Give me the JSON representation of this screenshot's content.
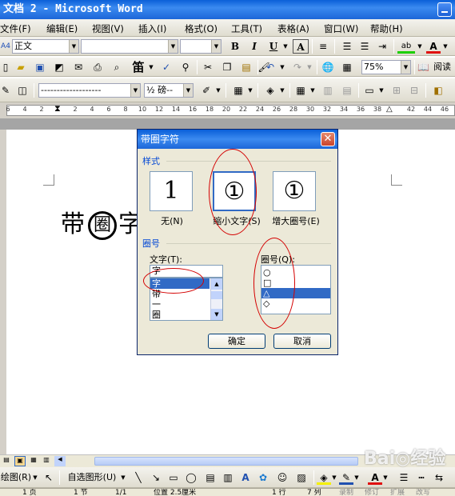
{
  "window": {
    "title": "文档 2 - Microsoft Word"
  },
  "menubar": {
    "items": [
      "文件(F)",
      "编辑(E)",
      "视图(V)",
      "插入(I)",
      "格式(O)",
      "工具(T)",
      "表格(A)",
      "窗口(W)",
      "帮助(H)"
    ]
  },
  "format_toolbar": {
    "style_value": "正文",
    "bold": "B",
    "italic": "I",
    "underline": "U",
    "char_border": "A",
    "highlight": "ab",
    "font_color": "A"
  },
  "standard_toolbar": {
    "zoom_value": "75%",
    "read_label": "阅读",
    "char_button": "笛"
  },
  "third_toolbar": {
    "line_style": "-------------------",
    "line_weight": "½ 磅--"
  },
  "ruler": {
    "ticks": [
      "6",
      "4",
      "2",
      "2",
      "4",
      "6",
      "8",
      "10",
      "12",
      "14",
      "16",
      "18",
      "20",
      "22",
      "24",
      "26",
      "28",
      "30",
      "32",
      "34",
      "36",
      "38",
      "42",
      "44",
      "46"
    ]
  },
  "document": {
    "sample_text": "带",
    "sample_circled": "圈",
    "sample_after": "字"
  },
  "dialog": {
    "title": "带圈字符",
    "style_group": "样式",
    "styles": [
      {
        "glyph": "1",
        "label": "无(N)"
      },
      {
        "glyph": "①",
        "label": "缩小文字(S)"
      },
      {
        "glyph": "①",
        "label": "增大圈号(E)"
      }
    ],
    "circle_group": "圈号",
    "text_label": "文字(T):",
    "text_value": "字",
    "text_items": [
      "字",
      "带",
      "一",
      "圈"
    ],
    "shape_label": "圈号(Q):",
    "shape_items": [
      "○",
      "□",
      "△",
      "◇"
    ],
    "ok_label": "确定",
    "cancel_label": "取消"
  },
  "draw_toolbar": {
    "draw_label": "绘图(R)",
    "autoshape_label": "自选图形(U)"
  },
  "statusbar": {
    "page": "1 页",
    "section": "1 节",
    "pages": "1/1",
    "position": "位置 2.5厘米",
    "line": "1 行",
    "column": "7 列",
    "rec": "录制",
    "trk": "修订",
    "ext": "扩展",
    "ovr": "改写"
  },
  "watermark": "Bai◎经验",
  "colors": {
    "title_blue": "#0a5fd8",
    "selection": "#316ac5",
    "annotation_red": "#d40000"
  }
}
